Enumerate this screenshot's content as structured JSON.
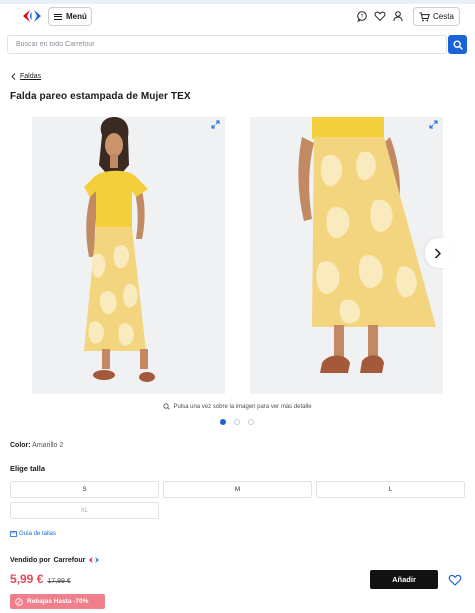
{
  "header": {
    "menu_label": "Menú",
    "cart_label": "Cesta",
    "icons": [
      "carrefour-logo",
      "chat-icon",
      "heart-icon",
      "user-icon",
      "cart-icon"
    ]
  },
  "search": {
    "placeholder": "Buscar en todo Carrefour"
  },
  "breadcrumb": {
    "back_label": "Faldas"
  },
  "product": {
    "title": "Falda pareo estampada de Mujer TEX",
    "zoom_hint": "Pulsa una vez sobre la imagen para ver más detalle",
    "images_count": 3,
    "active_image": 1,
    "color_label": "Color:",
    "color_value": "Amarillo 2",
    "size_title": "Elige talla",
    "sizes": [
      {
        "label": "S",
        "available": true
      },
      {
        "label": "M",
        "available": true
      },
      {
        "label": "L",
        "available": true
      },
      {
        "label": "XL",
        "available": false
      }
    ],
    "size_guide": "Guía de tallas",
    "seller_prefix": "Vendido por",
    "seller_name": "Carrefour",
    "price": "5,99 €",
    "old_price": "17,99 €",
    "sale_badge": "Rebajas Hasta -70%",
    "add_label": "Añadir"
  },
  "colors": {
    "brand_blue": "#1b63d8",
    "brand_red": "#e3001b",
    "price_red": "#e04b5b",
    "badge_pink": "#f07f8c",
    "skirt_yellow": "#f2d57e",
    "top_yellow": "#f3cf3c"
  }
}
